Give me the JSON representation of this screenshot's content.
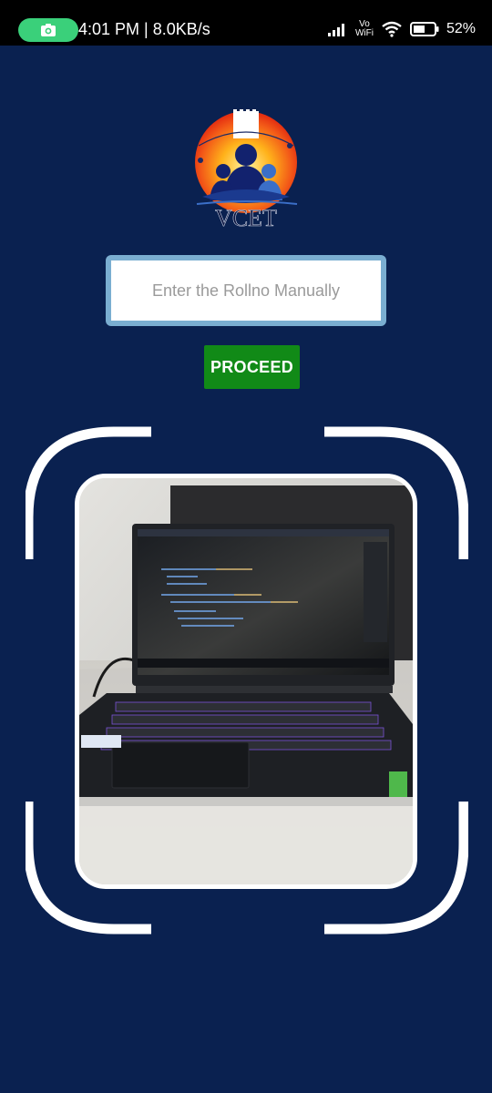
{
  "status_bar": {
    "time_speed": "4:01 PM | 8.0KB/s",
    "vowifi_top": "Vo",
    "vowifi_bottom": "WiFi",
    "battery": "52%"
  },
  "logo": {
    "text": "VCET"
  },
  "roll_input": {
    "placeholder": "Enter the Rollno Manually",
    "value": ""
  },
  "proceed_button": {
    "label": "PROCEED"
  },
  "colors": {
    "background": "#0a2150",
    "button": "#118a17",
    "input_border": "#7aaed1",
    "frame": "#ffffff"
  }
}
